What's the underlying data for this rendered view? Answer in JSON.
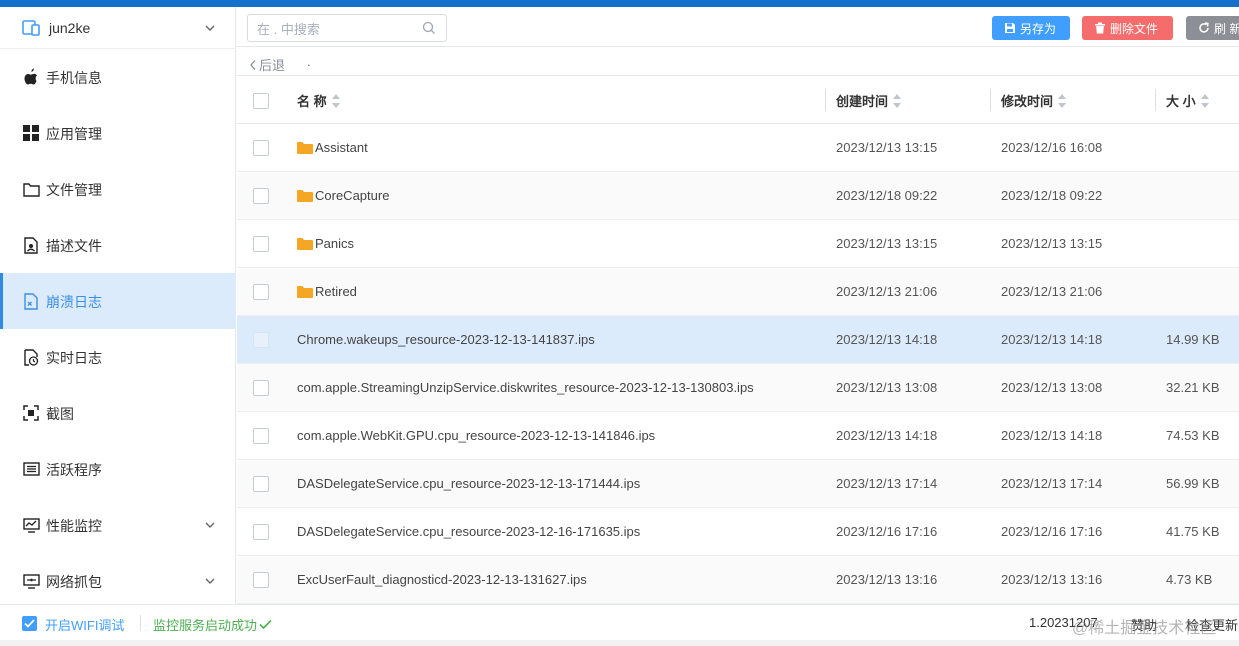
{
  "device": {
    "name": "jun2ke",
    "icon": "device-icon"
  },
  "sidebar": {
    "items": [
      {
        "label": "手机信息",
        "icon": "apple-icon"
      },
      {
        "label": "应用管理",
        "icon": "apps-grid-icon"
      },
      {
        "label": "文件管理",
        "icon": "folder-icon"
      },
      {
        "label": "描述文件",
        "icon": "profile-doc-icon"
      },
      {
        "label": "崩溃日志",
        "icon": "crash-log-icon",
        "active": true
      },
      {
        "label": "实时日志",
        "icon": "realtime-log-icon"
      },
      {
        "label": "截图",
        "icon": "screenshot-icon"
      },
      {
        "label": "活跃程序",
        "icon": "active-apps-icon"
      },
      {
        "label": "性能监控",
        "icon": "performance-icon",
        "expandable": true
      },
      {
        "label": "网络抓包",
        "icon": "network-capture-icon",
        "expandable": true
      }
    ]
  },
  "toolbar": {
    "search_placeholder": "在 . 中搜索",
    "save_as": "另存为",
    "delete_file": "删除文件",
    "refresh": "刷 新"
  },
  "breadcrumb": {
    "back": "后退",
    "path": "."
  },
  "table": {
    "headers": {
      "name": "名 称",
      "created": "创建时间",
      "modified": "修改时间",
      "size": "大 小"
    },
    "rows": [
      {
        "name": "Assistant",
        "folder": true,
        "created": "2023/12/13 13:15",
        "modified": "2023/12/16 16:08",
        "size": ""
      },
      {
        "name": "CoreCapture",
        "folder": true,
        "created": "2023/12/18 09:22",
        "modified": "2023/12/18 09:22",
        "size": ""
      },
      {
        "name": "Panics",
        "folder": true,
        "created": "2023/12/13 13:15",
        "modified": "2023/12/13 13:15",
        "size": ""
      },
      {
        "name": "Retired",
        "folder": true,
        "created": "2023/12/13 21:06",
        "modified": "2023/12/13 21:06",
        "size": ""
      },
      {
        "name": "Chrome.wakeups_resource-2023-12-13-141837.ips",
        "folder": false,
        "created": "2023/12/13 14:18",
        "modified": "2023/12/13 14:18",
        "size": "14.99 KB",
        "selected": true
      },
      {
        "name": "com.apple.StreamingUnzipService.diskwrites_resource-2023-12-13-130803.ips",
        "folder": false,
        "created": "2023/12/13 13:08",
        "modified": "2023/12/13 13:08",
        "size": "32.21 KB"
      },
      {
        "name": "com.apple.WebKit.GPU.cpu_resource-2023-12-13-141846.ips",
        "folder": false,
        "created": "2023/12/13 14:18",
        "modified": "2023/12/13 14:18",
        "size": "74.53 KB"
      },
      {
        "name": "DASDelegateService.cpu_resource-2023-12-13-171444.ips",
        "folder": false,
        "created": "2023/12/13 17:14",
        "modified": "2023/12/13 17:14",
        "size": "56.99 KB"
      },
      {
        "name": "DASDelegateService.cpu_resource-2023-12-16-171635.ips",
        "folder": false,
        "created": "2023/12/16 17:16",
        "modified": "2023/12/16 17:16",
        "size": "41.75 KB"
      },
      {
        "name": "ExcUserFault_diagnosticd-2023-12-13-131627.ips",
        "folder": false,
        "created": "2023/12/13 13:16",
        "modified": "2023/12/13 13:16",
        "size": "4.73 KB"
      }
    ]
  },
  "status": {
    "wifi_debug": "开启WIFI调试",
    "wifi_checked": true,
    "monitor": "监控服务启动成功",
    "version": "1.20231207",
    "sponsor": "赞助",
    "check_update": "检查更新"
  },
  "watermark": "@稀土掘金技术社区",
  "colors": {
    "accent": "#409eff",
    "danger": "#f56c6c",
    "neutral": "#8c8f95",
    "success": "#4caf50",
    "selected_row": "#dcebfb",
    "folder": "#f5a623",
    "topbar": "#1570c9"
  }
}
